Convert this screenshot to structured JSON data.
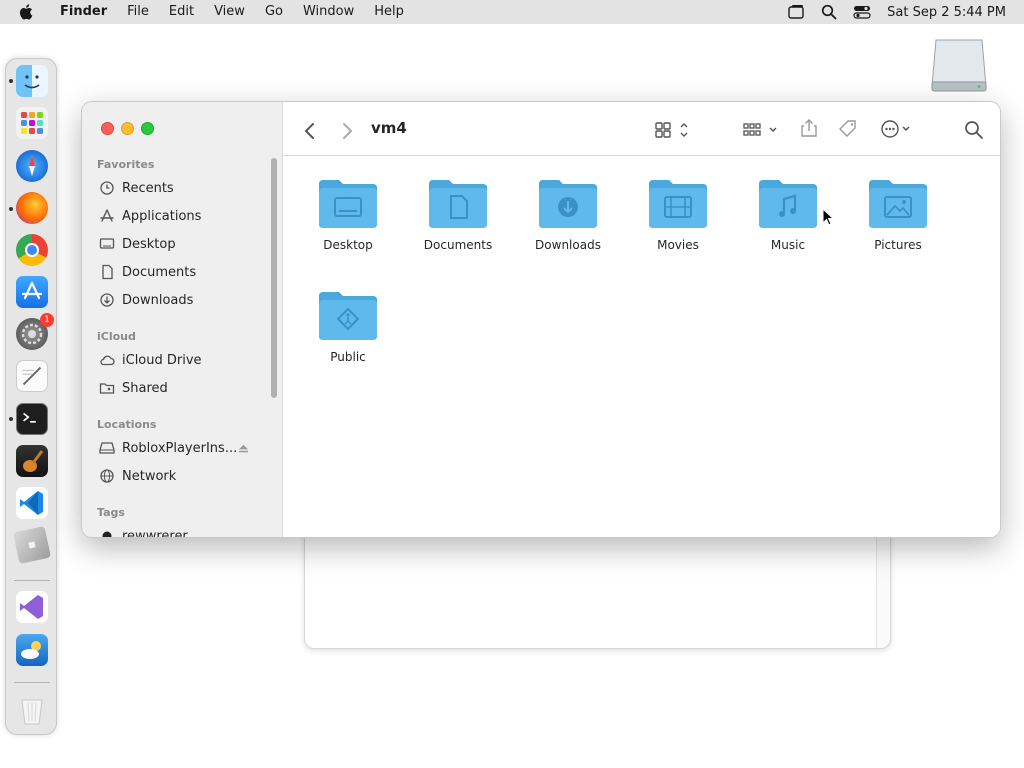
{
  "menubar": {
    "app_name": "Finder",
    "items": [
      "File",
      "Edit",
      "View",
      "Go",
      "Window",
      "Help"
    ],
    "datetime": "Sat Sep 2  5:44 PM"
  },
  "dock": {
    "apps": [
      "finder",
      "launchpad",
      "safari",
      "firefox",
      "chrome",
      "app-store",
      "system-settings",
      "textedit",
      "terminal",
      "garageband",
      "vscode",
      "roblox",
      "visual-studio",
      "weather",
      "trash"
    ],
    "system_settings_badge": "1"
  },
  "finder": {
    "path_title": "vm4",
    "sidebar": {
      "favorites_header": "Favorites",
      "favorites": [
        "Recents",
        "Applications",
        "Desktop",
        "Documents",
        "Downloads"
      ],
      "icloud_header": "iCloud",
      "icloud": [
        "iCloud Drive",
        "Shared"
      ],
      "locations_header": "Locations",
      "locations": [
        "RobloxPlayerIns...",
        "Network"
      ],
      "tags_header": "Tags",
      "tags": [
        "rewwrerer"
      ]
    },
    "folders": [
      "Desktop",
      "Documents",
      "Downloads",
      "Movies",
      "Music",
      "Pictures",
      "Public"
    ]
  },
  "colors": {
    "folder_blue": "#5fb9ea",
    "folder_tab": "#4aa8dc",
    "accent": "#007aff"
  }
}
